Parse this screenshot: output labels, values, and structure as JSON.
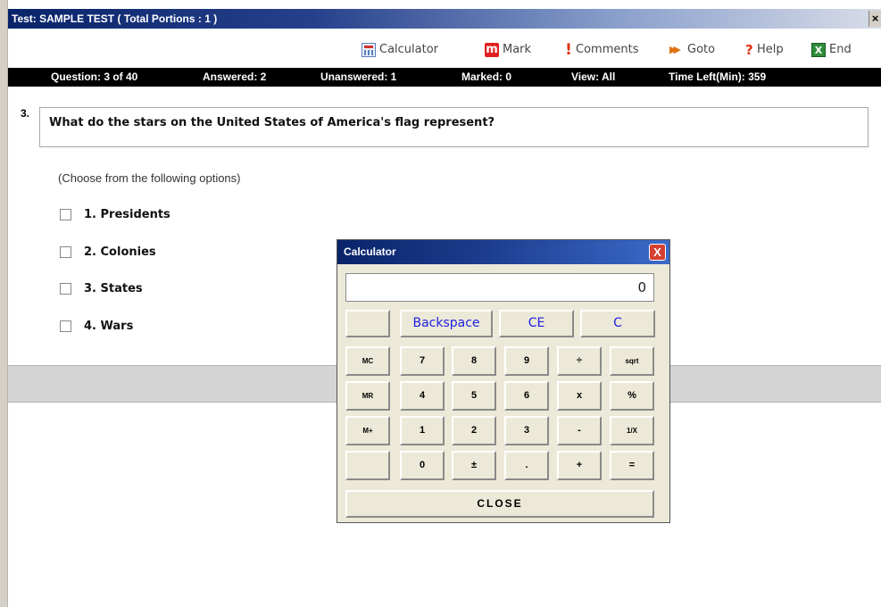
{
  "window": {
    "title": "Test: SAMPLE TEST ( Total Portions : 1 )",
    "close_glyph": "×"
  },
  "toolbar": {
    "calculator": "Calculator",
    "mark_icon": "m",
    "mark": "Mark",
    "comments_icon": "!",
    "comments": "Comments",
    "goto_icon": "▶▶",
    "goto": "Goto",
    "help_icon": "?",
    "help": "Help",
    "end_icon": "X",
    "end": "End"
  },
  "status": {
    "question": "Question: 3 of 40",
    "answered": "Answered: 2",
    "unanswered": "Unanswered: 1",
    "marked": "Marked: 0",
    "view": "View: All",
    "time_left": "Time Left(Min): 359"
  },
  "question": {
    "number": "3.",
    "text": "What do the stars on the United States of America's flag represent?",
    "instructions": "(Choose from the following options)",
    "options": [
      "1. Presidents",
      "2. Colonies",
      "3. States",
      "4. Wars"
    ]
  },
  "calculator": {
    "title": "Calculator",
    "close_glyph": "X",
    "display": "0",
    "top_row": [
      "",
      "Backspace",
      "CE",
      "C"
    ],
    "rows": [
      [
        "MC",
        "7",
        "8",
        "9",
        "÷",
        "sqrt"
      ],
      [
        "MR",
        "4",
        "5",
        "6",
        "x",
        "%"
      ],
      [
        "M+",
        "1",
        "2",
        "3",
        "-",
        "1/X"
      ],
      [
        "",
        "0",
        "±",
        ".",
        "+",
        "="
      ]
    ],
    "close_label": "CLOSE"
  },
  "colors": {
    "title_bar": "#0a246a",
    "status_bar": "#000000",
    "calc_face": "#ece9d8",
    "blue_keys": "#2020e0",
    "close_red": "#d54030"
  },
  "icons": [
    "calculator-icon",
    "mark-icon",
    "comments-icon",
    "goto-icon",
    "help-icon",
    "end-icon",
    "checkbox-icon",
    "close-icon"
  ]
}
